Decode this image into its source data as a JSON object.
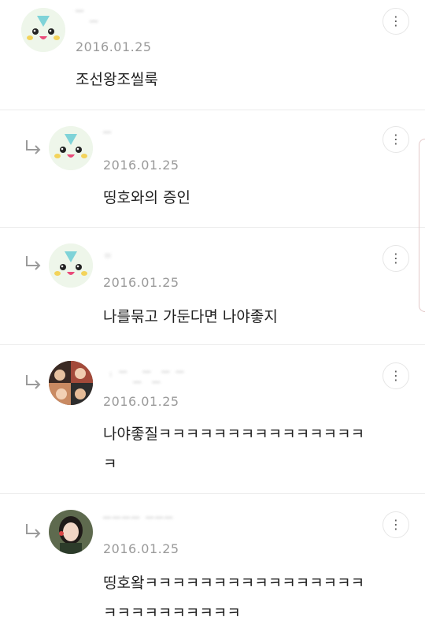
{
  "comments": [
    {
      "name": "",
      "date": "2016.01.25",
      "text": "조선왕조씰룩",
      "reply": false,
      "avatar": "mascot-avatar"
    },
    {
      "name": "",
      "date": "2016.01.25",
      "text": "띵호와의 증인",
      "reply": true,
      "avatar": "mascot-avatar"
    },
    {
      "name": "",
      "date": "2016.01.25",
      "text": "나를묶고 가둔다면 나야좋지",
      "reply": true,
      "avatar": "mascot-avatar"
    },
    {
      "name": "",
      "date": "2016.01.25",
      "text": "나야좋질ㅋㅋㅋㅋㅋㅋㅋㅋㅋㅋㅋㅋㅋㅋㅋㅋ",
      "reply": true,
      "avatar": "group-photo-avatar"
    },
    {
      "name": "",
      "date": "2016.01.25",
      "text": "띵호왘ㅋㅋㅋㅋㅋㅋㅋㅋㅋㅋㅋㅋㅋㅋㅋㅋㅋㅋㅋㅋㅋㅋㅋㅋㅋㅋ",
      "reply": true,
      "avatar": "portrait-avatar"
    }
  ],
  "icons": {
    "more": "more-vertical-icon",
    "reply": "reply-arrow-icon"
  },
  "colors": {
    "date": "#9a9a9a",
    "divider": "#ececec",
    "avatar_bg": "#eef6ea"
  }
}
